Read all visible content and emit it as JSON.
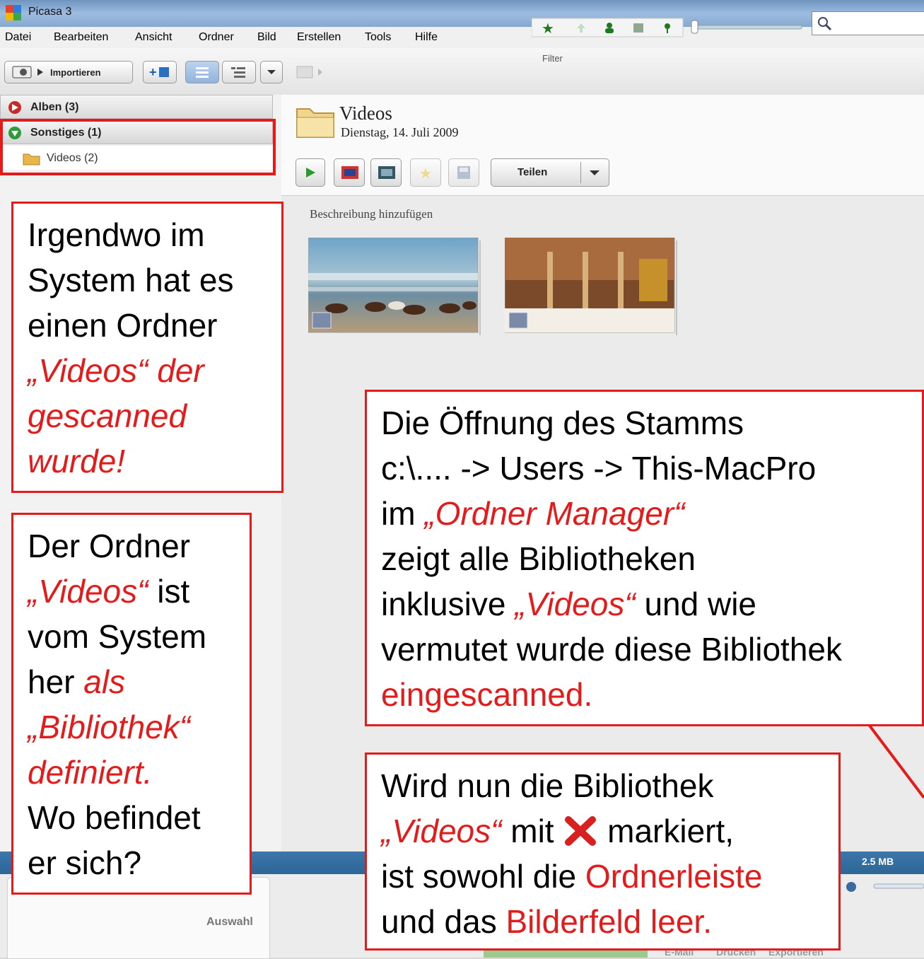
{
  "window": {
    "title": "Picasa 3"
  },
  "menu": [
    "Datei",
    "Bearbeiten",
    "Ansicht",
    "Ordner",
    "Bild",
    "Erstellen",
    "Tools",
    "Hilfe"
  ],
  "toolbar": {
    "import_label": "Importieren",
    "filter_label": "Filter",
    "search_placeholder": ""
  },
  "sidebar": {
    "groups": [
      {
        "label": "Alben (3)",
        "expanded": false
      },
      {
        "label": "Sonstiges (1)",
        "expanded": true
      }
    ],
    "folder": {
      "label": "Videos (2)"
    }
  },
  "album": {
    "title": "Videos",
    "date": "Dienstag, 14. Juli 2009",
    "share_label": "Teilen",
    "add_description": "Beschreibung hinzufügen",
    "thumbnails": [
      "beach-horses-video",
      "cathedral-interior-video"
    ]
  },
  "status": {
    "size": "2.5 MB"
  },
  "tray": {
    "label": "Auswahl",
    "actions": [
      "E-Mail",
      "Drucken",
      "Exportieren"
    ]
  },
  "annotations": {
    "a1": {
      "l1": "Irgendwo im",
      "l2": "System hat es",
      "l3": "einen Ordner",
      "l4": "„Videos“ der",
      "l5": "gescanned",
      "l6": "wurde!"
    },
    "a2": {
      "l1": "Der Ordner",
      "l2a": "„Videos“",
      "l2b": " ist",
      "l3": "vom System",
      "l4a": "her ",
      "l4b": "als",
      "l5": "„Bibliothek“",
      "l6": "definiert.",
      "l7": "Wo befindet",
      "l8": "er sich?"
    },
    "a3": {
      "l1": "Die Öffnung des Stamms",
      "l2": "c:\\.... -> Users -> This-MacPro",
      "l3a": "im ",
      "l3b": "„Ordner Manager“",
      "l4": "zeigt alle Bibliotheken",
      "l5a": "inklusive ",
      "l5b": "„Videos“",
      "l5c": " und wie",
      "l6": "vermutet wurde diese Bibliothek",
      "l7": "eingescanned."
    },
    "a4": {
      "l1": "Wird nun die Bibliothek",
      "l2a": "„Videos“",
      "l2b": " mit ",
      "l2c": " markiert,",
      "l3a": "ist sowohl die ",
      "l3b": "Ordnerleiste",
      "l4a": "und das ",
      "l4b": "Bilderfeld leer."
    }
  },
  "colors": {
    "accent_red": "#e31b1b",
    "status_blue": "#2c6596"
  }
}
